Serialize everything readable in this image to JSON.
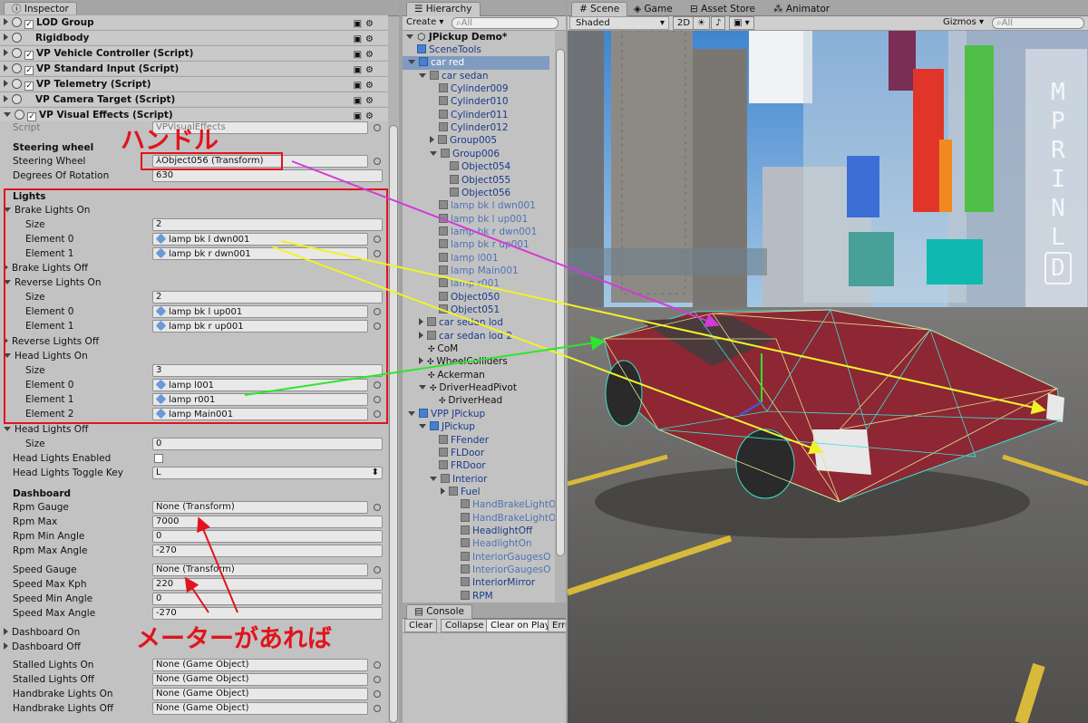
{
  "inspector": {
    "tab": "Inspector",
    "components": [
      "LOD Group",
      "Rigidbody",
      "VP Vehicle Controller (Script)",
      "VP Standard Input (Script)",
      "VP Telemetry (Script)",
      "VP Camera Target (Script)",
      "VP Visual Effects (Script)"
    ],
    "script_label": "Script",
    "script_value": "VPVisualEffects",
    "steering_header": "Steering wheel",
    "steering_wheel_label": "Steering Wheel",
    "steering_wheel_value": "Object056 (Transform)",
    "degrees_label": "Degrees Of Rotation",
    "degrees_value": "630",
    "lights_header": "Lights",
    "brake_on": "Brake Lights On",
    "size_label": "Size",
    "brake_size": "2",
    "el0": "Element 0",
    "el1": "Element 1",
    "el2": "Element 2",
    "brake_e0": "lamp bk l dwn001",
    "brake_e1": "lamp bk r dwn001",
    "brake_off": "Brake Lights Off",
    "reverse_on": "Reverse Lights On",
    "reverse_size": "2",
    "reverse_e0": "lamp bk l up001",
    "reverse_e1": "lamp bk r up001",
    "reverse_off": "Reverse Lights Off",
    "head_on": "Head Lights On",
    "head_size": "3",
    "head_e0": "lamp l001",
    "head_e1": "lamp r001",
    "head_e2": "lamp Main001",
    "head_off": "Head Lights Off",
    "head_off_size": "0",
    "head_enabled": "Head Lights Enabled",
    "head_toggle": "Head Lights Toggle Key",
    "head_toggle_value": "L",
    "dashboard_header": "Dashboard",
    "rpm_gauge": "Rpm Gauge",
    "rpm_gauge_value": "None (Transform)",
    "rpm_max": "Rpm Max",
    "rpm_max_value": "7000",
    "rpm_min_angle": "Rpm Min Angle",
    "rpm_min_angle_value": "0",
    "rpm_max_angle": "Rpm Max Angle",
    "rpm_max_angle_value": "-270",
    "speed_gauge": "Speed Gauge",
    "speed_gauge_value": "None (Transform)",
    "speed_max": "Speed Max Kph",
    "speed_max_value": "220",
    "speed_min_angle": "Speed Min Angle",
    "speed_min_angle_value": "0",
    "speed_max_angle": "Speed Max Angle",
    "speed_max_angle_value": "-270",
    "dash_on": "Dashboard On",
    "dash_off": "Dashboard Off",
    "stalled_on": "Stalled Lights On",
    "stalled_off": "Stalled Lights Off",
    "handbrake_on": "Handbrake Lights On",
    "handbrake_off": "Handbrake Lights Off",
    "none_go": "None (Game Object)"
  },
  "annotations": {
    "handle": "ハンドル",
    "meter": "メーターがあれば"
  },
  "hierarchy": {
    "tab": "Hierarchy",
    "create": "Create",
    "search_placeholder": "All",
    "root": "JPickup Demo*",
    "items": [
      {
        "label": "SceneTools",
        "indent": 1,
        "kind": "b"
      },
      {
        "label": "car red",
        "indent": 1,
        "kind": "b",
        "selected": true
      },
      {
        "label": "car sedan",
        "indent": 2,
        "kind": "g"
      },
      {
        "label": "Cylinder009",
        "indent": 3,
        "kind": "g"
      },
      {
        "label": "Cylinder010",
        "indent": 3,
        "kind": "g"
      },
      {
        "label": "Cylinder011",
        "indent": 3,
        "kind": "g"
      },
      {
        "label": "Cylinder012",
        "indent": 3,
        "kind": "g"
      },
      {
        "label": "Group005",
        "indent": 3,
        "kind": "g"
      },
      {
        "label": "Group006",
        "indent": 3,
        "kind": "g"
      },
      {
        "label": "Object054",
        "indent": 4,
        "kind": "g"
      },
      {
        "label": "Object055",
        "indent": 4,
        "kind": "g"
      },
      {
        "label": "Object056",
        "indent": 4,
        "kind": "g"
      },
      {
        "label": "lamp bk l dwn001",
        "indent": 3,
        "kind": "g"
      },
      {
        "label": "lamp bk l up001",
        "indent": 3,
        "kind": "g"
      },
      {
        "label": "lamp bk r dwn001",
        "indent": 3,
        "kind": "g"
      },
      {
        "label": "lamp bk r up001",
        "indent": 3,
        "kind": "g"
      },
      {
        "label": "lamp l001",
        "indent": 3,
        "kind": "g"
      },
      {
        "label": "lamp Main001",
        "indent": 3,
        "kind": "g"
      },
      {
        "label": "lamp r001",
        "indent": 3,
        "kind": "g"
      },
      {
        "label": "Object050",
        "indent": 3,
        "kind": "g"
      },
      {
        "label": "Object051",
        "indent": 3,
        "kind": "g"
      },
      {
        "label": "car sedan lod",
        "indent": 2,
        "kind": "g"
      },
      {
        "label": "car sedan lod 2",
        "indent": 2,
        "kind": "g"
      },
      {
        "label": "CoM",
        "indent": 2,
        "kind": "n"
      },
      {
        "label": "WheelColliders",
        "indent": 2,
        "kind": "n"
      },
      {
        "label": "Ackerman",
        "indent": 2,
        "kind": "n"
      },
      {
        "label": "DriverHeadPivot",
        "indent": 2,
        "kind": "n"
      },
      {
        "label": "DriverHead",
        "indent": 3,
        "kind": "n"
      },
      {
        "label": "VPP JPickup",
        "indent": 1,
        "kind": "b"
      },
      {
        "label": "JPickup",
        "indent": 2,
        "kind": "b"
      },
      {
        "label": "FFender",
        "indent": 3,
        "kind": "g"
      },
      {
        "label": "FLDoor",
        "indent": 3,
        "kind": "g"
      },
      {
        "label": "FRDoor",
        "indent": 3,
        "kind": "g"
      },
      {
        "label": "Interior",
        "indent": 3,
        "kind": "g"
      },
      {
        "label": "Fuel",
        "indent": 4,
        "kind": "g"
      },
      {
        "label": "HandBrakeLightO",
        "indent": 5,
        "kind": "g"
      },
      {
        "label": "HandBrakeLightO",
        "indent": 5,
        "kind": "g"
      },
      {
        "label": "HeadlightOff",
        "indent": 5,
        "kind": "g"
      },
      {
        "label": "HeadlightOn",
        "indent": 5,
        "kind": "g"
      },
      {
        "label": "InteriorGaugesO",
        "indent": 5,
        "kind": "g"
      },
      {
        "label": "InteriorGaugesO",
        "indent": 5,
        "kind": "g"
      },
      {
        "label": "InteriorMirror",
        "indent": 5,
        "kind": "g"
      },
      {
        "label": "RPM",
        "indent": 5,
        "kind": "g"
      }
    ]
  },
  "console": {
    "tab": "Console",
    "clear": "Clear",
    "collapse": "Collapse",
    "clear_on_play": "Clear on Play",
    "error_pause": "Erro"
  },
  "scene": {
    "tabs": [
      "Scene",
      "Game",
      "Asset Store",
      "Animator"
    ],
    "shaded": "Shaded",
    "mode2d": "2D",
    "gizmos": "Gizmos",
    "search_placeholder": "All",
    "sign_letters": [
      "M",
      "P",
      "R",
      "I",
      "N",
      "L",
      "D"
    ]
  }
}
